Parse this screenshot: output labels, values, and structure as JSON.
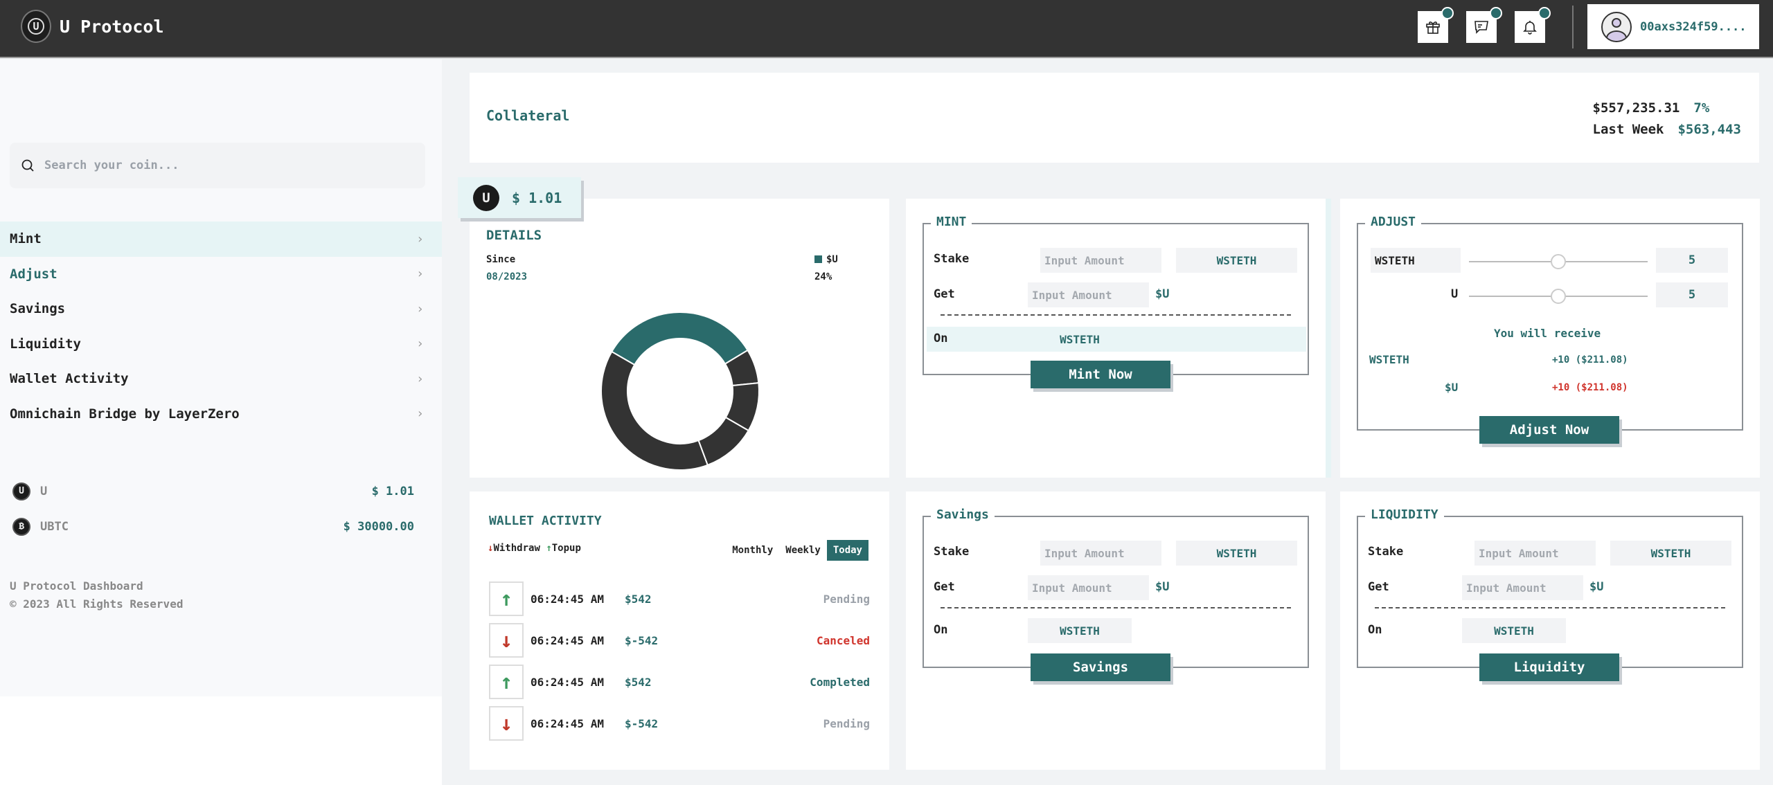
{
  "header": {
    "app_title": "U Protocol",
    "logo_icon": "u-protocol-logo",
    "icons": [
      {
        "name": "gift-icon",
        "has_badge": true
      },
      {
        "name": "chat-icon",
        "has_badge": true
      },
      {
        "name": "bell-icon",
        "has_badge": true
      }
    ],
    "wallet_address": "00axs324f59...."
  },
  "sidebar": {
    "search": {
      "placeholder": "Search your coin...",
      "value": ""
    },
    "nav": [
      {
        "label": "Mint",
        "state": "active"
      },
      {
        "label": "Adjust",
        "state": "highlighted"
      },
      {
        "label": "Savings",
        "state": "normal"
      },
      {
        "label": "Liquidity",
        "state": "normal"
      },
      {
        "label": "Wallet Activity",
        "state": "normal"
      },
      {
        "label": "Omnichain Bridge by LayerZero",
        "state": "normal"
      }
    ],
    "coins": [
      {
        "symbol": "U",
        "glyph": "U",
        "price": "$ 1.01"
      },
      {
        "symbol": "UBTC",
        "glyph": "₿",
        "price": "$ 30000.00"
      }
    ],
    "footer": {
      "line1": "U Protocol Dashboard",
      "line2": "© 2023 All Rights Reserved"
    }
  },
  "collateral": {
    "title": "Collateral",
    "value": "$557,235.31",
    "change": "7%",
    "last_week_label": "Last Week",
    "last_week_value": "$563,443"
  },
  "price_tag": {
    "glyph": "U",
    "value": "$ 1.01"
  },
  "details": {
    "title": "DETAILS",
    "since_label": "Since",
    "since_value": "08/2023",
    "legend_label": "$U",
    "legend_value": "24%"
  },
  "chart_data": {
    "type": "pie",
    "variant": "donut",
    "title": "DETAILS",
    "legend": [
      {
        "label": "$U",
        "value": "24%"
      }
    ],
    "slices": [
      {
        "label": "$U",
        "value": 33,
        "color": "#2a6b6b"
      },
      {
        "label": "other-1",
        "value": 7,
        "color": "#333333"
      },
      {
        "label": "other-2",
        "value": 10,
        "color": "#333333"
      },
      {
        "label": "other-3",
        "value": 11,
        "color": "#333333"
      },
      {
        "label": "other-4",
        "value": 39,
        "color": "#333333"
      }
    ],
    "start_angle_deg": -60
  },
  "mint": {
    "title": "MINT",
    "stake_label": "Stake",
    "stake_placeholder": "Input Amount",
    "stake_token": "WSTETH",
    "get_label": "Get",
    "get_placeholder": "Input Amount",
    "get_unit": "$U",
    "on_label": "On",
    "on_token": "WSTETH",
    "button": "Mint Now"
  },
  "adjust": {
    "title": "ADJUST",
    "sliders": [
      {
        "label": "WSTETH",
        "value": "5",
        "fraction": 0.5
      },
      {
        "label": "U",
        "value": "5",
        "fraction": 0.5
      }
    ],
    "receive_title": "You will receive",
    "receive": [
      {
        "token": "WSTETH",
        "amount": "+10 ($211.08)",
        "color": "#2a6b6b"
      },
      {
        "token": "$U",
        "amount": "+10 ($211.08)",
        "color": "#d0342c"
      }
    ],
    "button": "Adjust Now"
  },
  "wallet_activity": {
    "title": "WALLET ACTIVITY",
    "legend_withdraw": "Withdraw",
    "legend_topup": "Topup",
    "tabs": [
      {
        "label": "Monthly",
        "active": false
      },
      {
        "label": "Weekly",
        "active": false
      },
      {
        "label": "Today",
        "active": true
      }
    ],
    "transactions": [
      {
        "direction": "up",
        "time": "06:24:45 AM",
        "amount": "$542",
        "status": "Pending",
        "status_color": "#9aa0a8"
      },
      {
        "direction": "down",
        "time": "06:24:45 AM",
        "amount": "$-542",
        "status": "Canceled",
        "status_color": "#d0342c"
      },
      {
        "direction": "up",
        "time": "06:24:45 AM",
        "amount": "$542",
        "status": "Completed",
        "status_color": "#2a6b6b"
      },
      {
        "direction": "down",
        "time": "06:24:45 AM",
        "amount": "$-542",
        "status": "Pending",
        "status_color": "#9aa0a8"
      }
    ]
  },
  "savings": {
    "title": "Savings",
    "stake_label": "Stake",
    "stake_placeholder": "Input Amount",
    "stake_token": "WSTETH",
    "get_label": "Get",
    "get_placeholder": "Input Amount",
    "get_unit": "$U",
    "on_label": "On",
    "on_token": "WSTETH",
    "button": "Savings"
  },
  "liquidity": {
    "title": "LIQUIDITY",
    "stake_label": "Stake",
    "stake_placeholder": "Input Amount",
    "stake_token": "WSTETH",
    "get_label": "Get",
    "get_placeholder": "Input Amount",
    "get_unit": "$U",
    "on_label": "On",
    "on_token": "WSTETH",
    "button": "Liquidity"
  },
  "colors": {
    "accent": "#2a6b6b",
    "topbar": "#333333",
    "danger": "#d0342c",
    "success": "#3e9a5f"
  }
}
